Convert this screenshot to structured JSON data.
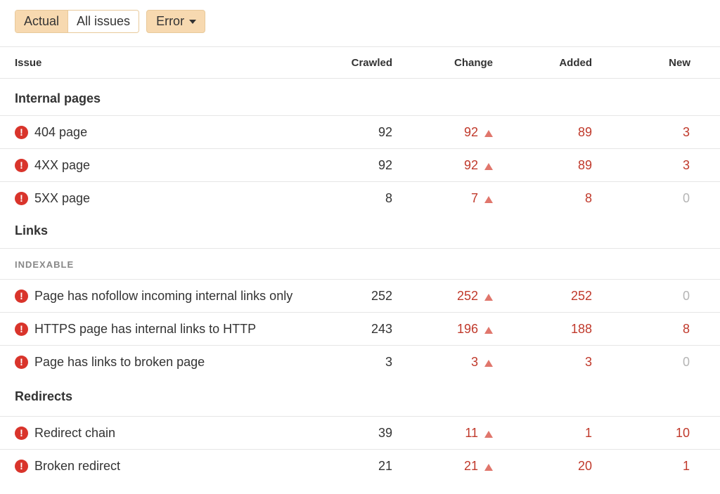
{
  "toolbar": {
    "actual_label": "Actual",
    "all_issues_label": "All issues",
    "filter_label": "Error"
  },
  "columns": {
    "issue": "Issue",
    "crawled": "Crawled",
    "change": "Change",
    "added": "Added",
    "new": "New"
  },
  "sections": {
    "internal_pages": "Internal pages",
    "links": "Links",
    "links_sub": "INDEXABLE",
    "redirects": "Redirects"
  },
  "rows": [
    {
      "issue": "404 page",
      "crawled": "92",
      "change": "92",
      "added": "89",
      "new": "3"
    },
    {
      "issue": "4XX page",
      "crawled": "92",
      "change": "92",
      "added": "89",
      "new": "3"
    },
    {
      "issue": "5XX page",
      "crawled": "8",
      "change": "7",
      "added": "8",
      "new": "0"
    },
    {
      "issue": "Page has nofollow incoming internal links only",
      "crawled": "252",
      "change": "252",
      "added": "252",
      "new": "0"
    },
    {
      "issue": "HTTPS page has internal links to HTTP",
      "crawled": "243",
      "change": "196",
      "added": "188",
      "new": "8"
    },
    {
      "issue": "Page has links to broken page",
      "crawled": "3",
      "change": "3",
      "added": "3",
      "new": "0"
    },
    {
      "issue": "Redirect chain",
      "crawled": "39",
      "change": "11",
      "added": "1",
      "new": "10"
    },
    {
      "issue": "Broken redirect",
      "crawled": "21",
      "change": "21",
      "added": "20",
      "new": "1"
    }
  ],
  "icons": {
    "error": "error-icon",
    "increase": "triangle-up-icon",
    "dropdown": "caret-down-icon"
  },
  "colors": {
    "accent": "#f7d9b0",
    "error": "#d9342b",
    "positive_change": "#c0392b",
    "zero": "#b5b5b5"
  }
}
